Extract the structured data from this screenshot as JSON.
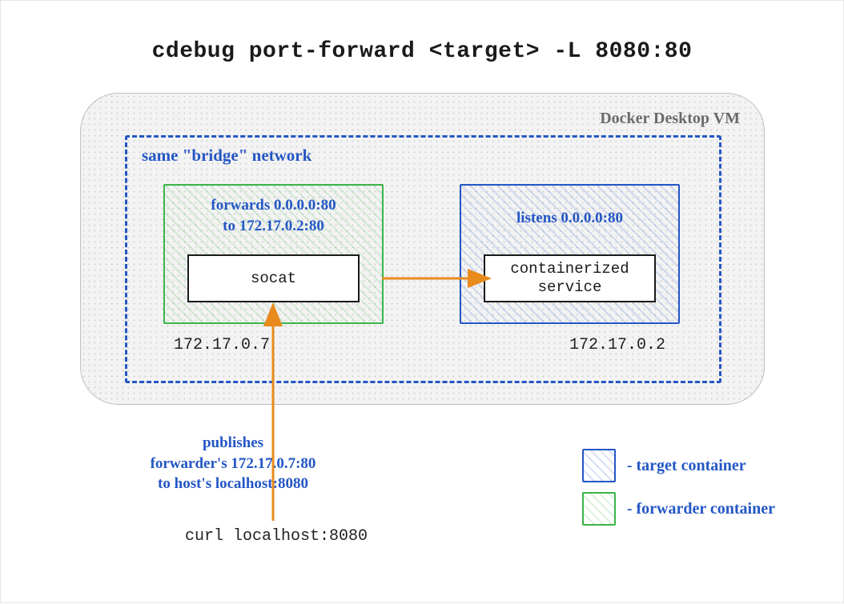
{
  "title": "cdebug port-forward <target> -L 8080:80",
  "vm": {
    "label": "Docker Desktop VM"
  },
  "bridge": {
    "label": "same \"bridge\" network"
  },
  "forwarder": {
    "caption_line1": "forwards 0.0.0.0:80",
    "caption_line2": "to 172.17.0.2:80",
    "inner": "socat",
    "ip": "172.17.0.7"
  },
  "target": {
    "caption": "listens 0.0.0.0:80",
    "inner_line1": "containerized",
    "inner_line2": "service",
    "ip": "172.17.0.2"
  },
  "publish_note": {
    "line1": "publishes",
    "line2": "forwarder's 172.17.0.7:80",
    "line3": "to host's localhost:8080"
  },
  "curl": "curl localhost:8080",
  "legend": {
    "target": "- target container",
    "forwarder": "- forwarder container"
  },
  "colors": {
    "blue": "#2457c5",
    "green": "#3bb54a",
    "orange": "#e88b1c"
  }
}
